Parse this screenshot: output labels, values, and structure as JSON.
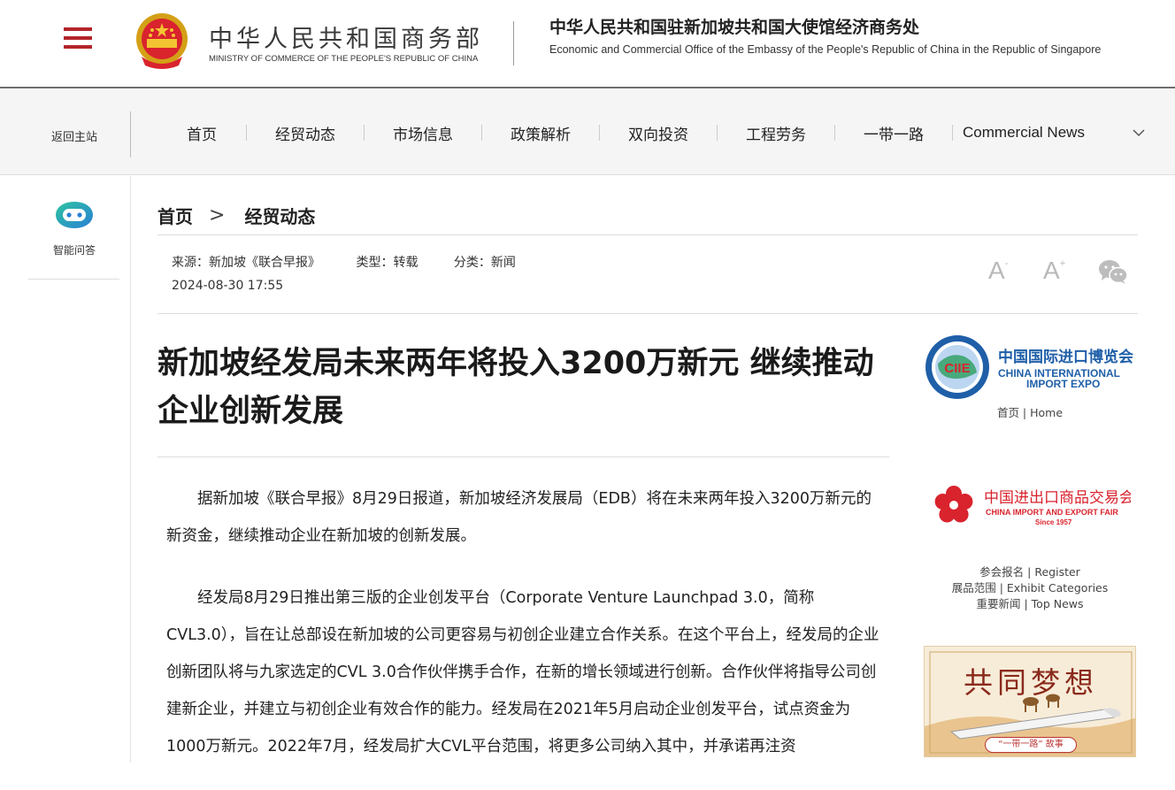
{
  "header": {
    "ministry_cn": "中华人民共和国商务部",
    "ministry_en": "MINISTRY OF COMMERCE OF THE PEOPLE'S REPUBLIC OF CHINA",
    "office_cn": "中华人民共和国驻新加坡共和国大使馆经济商务处",
    "office_en": "Economic and Commercial Office of the Embassy of the People's Republic of China in the Republic of Singapore"
  },
  "nav": {
    "back_home": "返回主站",
    "items": [
      "首页",
      "经贸动态",
      "市场信息",
      "政策解析",
      "双向投资",
      "工程劳务",
      "一带一路",
      "Commercial News"
    ]
  },
  "rail": {
    "bot_label": "智能问答"
  },
  "breadcrumb": {
    "home": "首页",
    "separator": ">",
    "current": "经贸动态"
  },
  "meta": {
    "source": "来源：新加坡《联合早报》",
    "type": "类型：转载",
    "category": "分类：新闻",
    "date": "2024-08-30 17:55",
    "font_small": "A",
    "font_large": "A",
    "font_small_sign": "-",
    "font_large_sign": "+"
  },
  "article": {
    "title": "新加坡经发局未来两年将投入3200万新元 继续推动企业创新发展",
    "paragraphs": [
      "据新加坡《联合早报》8月29日报道，新加坡经济发展局（EDB）将在未来两年投入3200万新元的新资金，继续推动企业在新加坡的创新发展。",
      "经发局8月29日推出第三版的企业创发平台（Corporate Venture Launchpad 3.0，简称CVL3.0），旨在让总部设在新加坡的公司更容易与初创企业建立合作关系。在这个平台上，经发局的企业创新团队将与九家选定的CVL 3.0合作伙伴携手合作，在新的增长领域进行创新。合作伙伴将指导公司创建新企业，并建立与初创企业有效合作的能力。经发局在2021年5月启动企业创发平台，试点资金为1000万新元。2022年7月，经发局扩大CVL平台范围，将更多公司纳入其中，并承诺再注资"
    ]
  },
  "sidebar": {
    "ciie": {
      "cn": "中国国际进口博览会",
      "en1": "CHINA INTERNATIONAL",
      "en2": "IMPORT EXPO",
      "badge": "CIIE",
      "links": [
        {
          "cn": "首页",
          "en": "Home"
        }
      ]
    },
    "fair": {
      "cn": "中国进出口商品交易会",
      "en": "CHINA IMPORT AND EXPORT FAIR",
      "since": "Since 1957",
      "links": [
        {
          "cn": "参会报名",
          "en": "Register"
        },
        {
          "cn": "展品范围",
          "en": "Exhibit Categories"
        },
        {
          "cn": "重要新闻",
          "en": "Top News"
        }
      ]
    },
    "banner": {
      "title": "共同梦想",
      "subtitle": "“一带一路” 故事"
    }
  },
  "colors": {
    "brand_red": "#b3252a",
    "nav_bg": "#f5f5f5",
    "ciie_blue": "#1f5fa8",
    "fair_red": "#d9232d"
  }
}
